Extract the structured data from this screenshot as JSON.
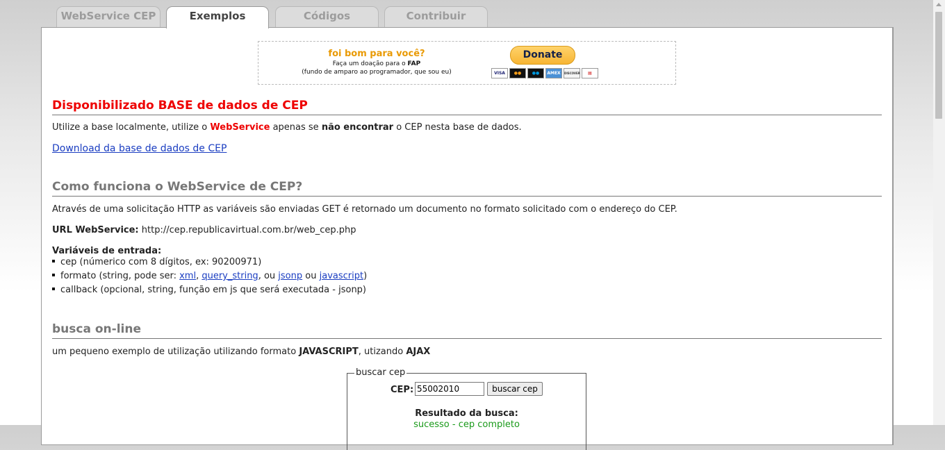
{
  "tabs": [
    {
      "label": "WebService CEP"
    },
    {
      "label": "Exemplos"
    },
    {
      "label": "Códigos"
    },
    {
      "label": "Contribuir"
    }
  ],
  "donate": {
    "title": "foi bom para você?",
    "line1_prefix": "Faça um doação para o ",
    "line1_bold": "FAP",
    "line2": "(fundo de amparo ao programador, que sou eu)",
    "button_label": "Donate",
    "cards": [
      "VISA",
      "MC",
      "Maestro",
      "AMEX",
      "DISCOVER",
      "eCheck"
    ]
  },
  "section1": {
    "title": "Disponibilizado BASE de dados de CEP",
    "text_1": "Utilize a base localmente, utilize o ",
    "text_red": "WebService",
    "text_2": " apenas se ",
    "text_bold": "não encontrar",
    "text_3": " o CEP nesta base de dados.",
    "download_link": "Download da base de dados de CEP"
  },
  "section2": {
    "title": "Como funciona o WebService de CEP?",
    "description": "Através de uma solicitação HTTP as variáveis são enviadas GET é retornado um documento no formato solicitado com o endereço do CEP.",
    "url_label": "URL WebService:",
    "url_value": " http://cep.republicavirtual.com.br/web_cep.php",
    "vars_title": "Variáveis de entrada:",
    "var_cep": "cep (númerico com 8 dígitos, ex: 90200971)",
    "var_formato_prefix": "formato (string, pode ser: ",
    "fmt_xml": "xml",
    "fmt_query": "query_string",
    "fmt_ou1": ", ou ",
    "fmt_jsonp": "jsonp",
    "fmt_ou2": " ou ",
    "fmt_js": "javascript",
    "var_callback": "callback (opcional, string, função em js que será executada - jsonp)"
  },
  "section3": {
    "title": "busca on-line",
    "text_1": "um pequeno exemplo de utilização utilizando formato ",
    "text_bold1": "JAVASCRIPT",
    "text_2": ", utizando ",
    "text_bold2": "AJAX"
  },
  "search_form": {
    "legend": "buscar cep",
    "cep_label": "CEP:",
    "cep_value": "55002010",
    "button_label": "buscar cep",
    "result_title": "Resultado da busca:",
    "result_status": "sucesso - cep completo"
  },
  "colors": {
    "accent_red": "#e00000",
    "link_blue": "#1a3dc1",
    "donate_orange": "#e99a05",
    "success_green": "#1a9a1a"
  }
}
